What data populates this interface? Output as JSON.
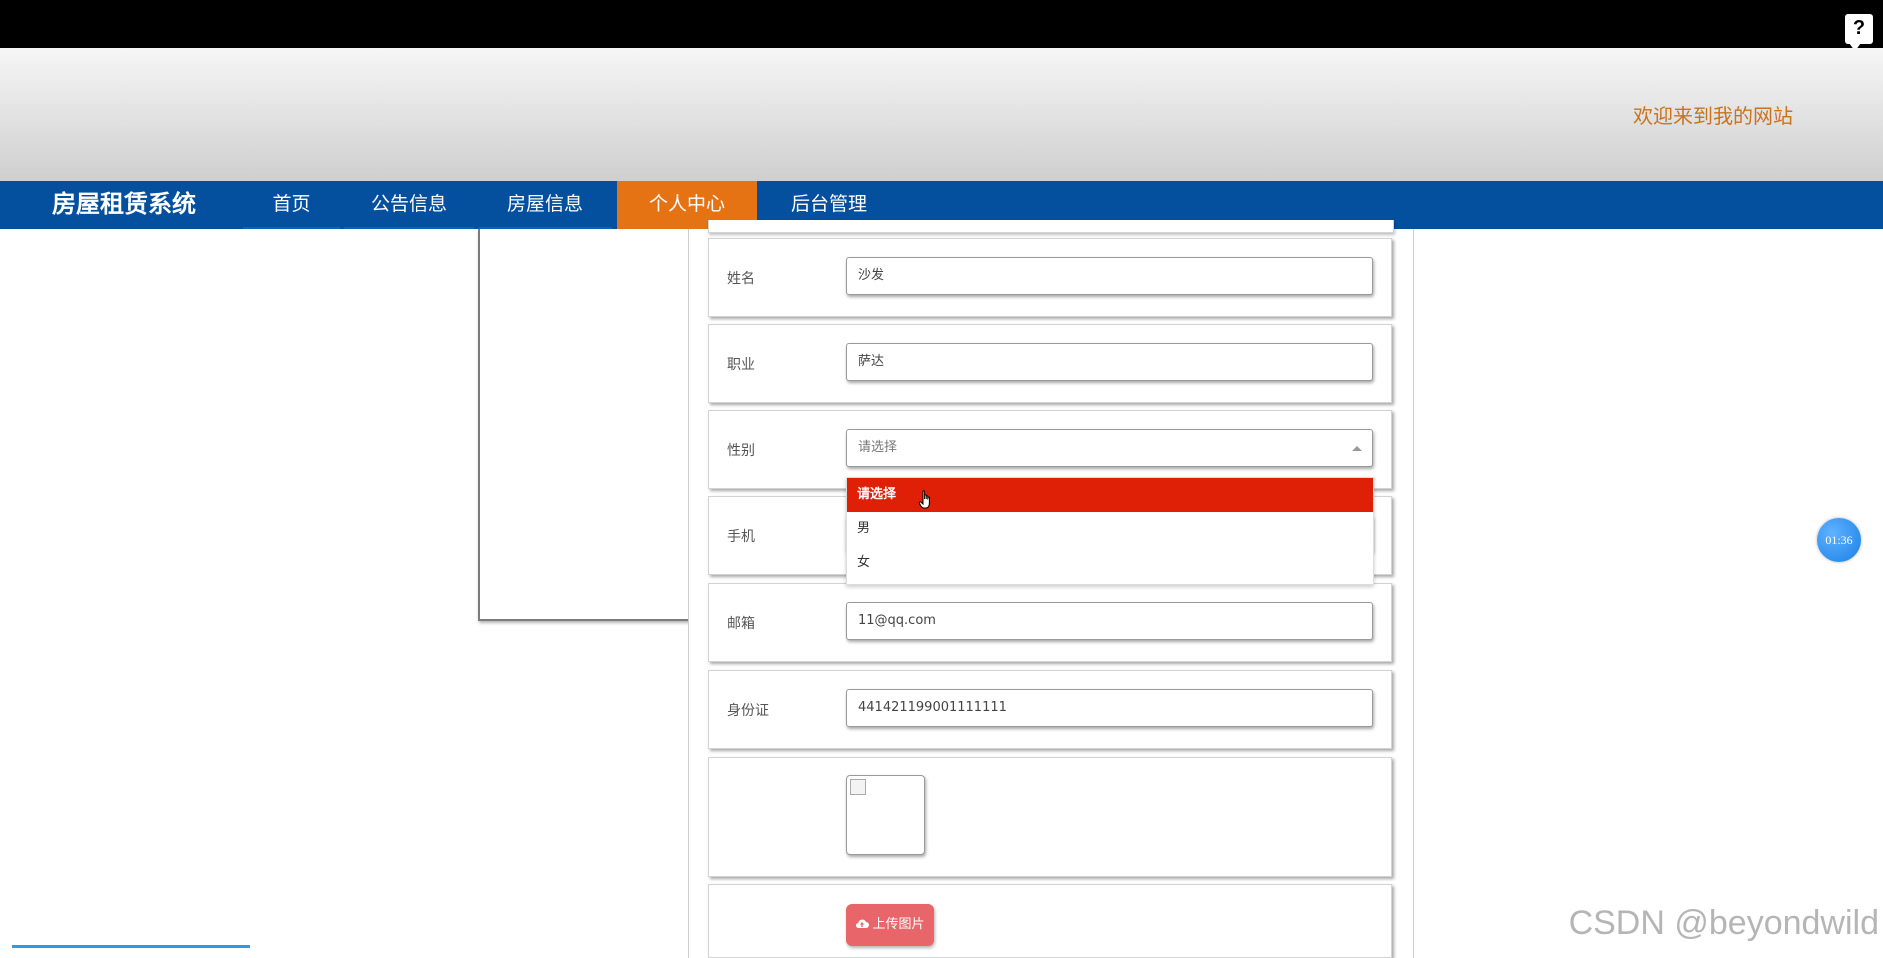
{
  "help_label": "?",
  "header": {
    "welcome": "欢迎来到我的网站"
  },
  "nav": {
    "brand": "房屋租赁系统",
    "items": [
      {
        "label": "首页"
      },
      {
        "label": "公告信息"
      },
      {
        "label": "房屋信息"
      },
      {
        "label": "个人中心",
        "active": true
      },
      {
        "label": "后台管理"
      }
    ],
    "colors": {
      "bar": "#04509e",
      "active": "#e67313"
    }
  },
  "form": {
    "name": {
      "label": "姓名",
      "value": "沙发"
    },
    "job": {
      "label": "职业",
      "value": "萨达"
    },
    "gender": {
      "label": "性别",
      "selected": "请选择",
      "options": [
        "请选择",
        "男",
        "女"
      ],
      "highlight_color": "#e01f07"
    },
    "phone": {
      "label": "手机"
    },
    "email": {
      "label": "邮箱",
      "value": "11@qq.com"
    },
    "id_card": {
      "label": "身份证",
      "value": "441421199001111111"
    },
    "image": {
      "icon": "broken-image-icon"
    },
    "upload": {
      "label": "上传图片",
      "icon": "cloud-upload-icon"
    }
  },
  "timer": "01:36",
  "watermark": "CSDN @beyondwild"
}
